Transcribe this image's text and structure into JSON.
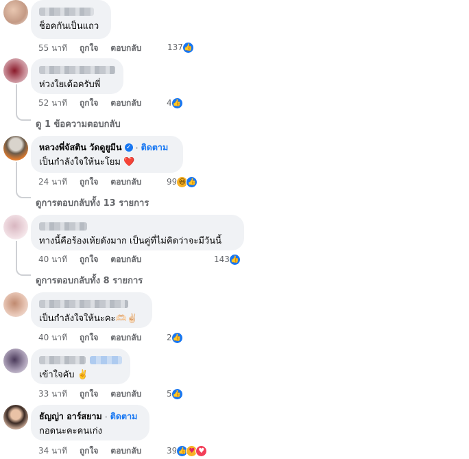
{
  "actions": {
    "like": "ถูกใจ",
    "reply": "ตอบกลับ"
  },
  "comments": [
    {
      "time": "55 นาที",
      "text": "ช็อคกันเป็นแถว",
      "count": "137"
    },
    {
      "time": "52 นาที",
      "text": "ห่วงใยเด้อครับพี่",
      "count": "4",
      "replies": "ดู 1 ข้อความตอบกลับ"
    },
    {
      "name": "หลวงพี่จัสติน วัดดูยูมีน",
      "follow": "ติดตาม",
      "time": "24 นาที",
      "text": "เป็นกำลังใจให้นะโยม ❤️",
      "count": "99",
      "replies": "ดูการตอบกลับทั้ง 13 รายการ"
    },
    {
      "time": "40 นาที",
      "text": "ทางนี้คือร้องเห้ยดังมาก เป็นคู่ที่ไม่คิดว่าจะมีวันนี้",
      "count": "143",
      "replies": "ดูการตอบกลับทั้ง 8 รายการ"
    },
    {
      "time": "40 นาที",
      "text": "เป็นกำลังใจให้นะคะ🫶🏻✌🏻",
      "count": "2"
    },
    {
      "time": "33 นาที",
      "text": "เข้าใจคับ ✌️",
      "count": "5"
    },
    {
      "name": "ธัญญ่า อาร์สยาม",
      "follow": "ติดตาม",
      "time": "34 นาที",
      "text": "กอดนะคะคนเก่ง",
      "count": "39"
    }
  ],
  "icons": [
    "like-reaction-icon",
    "haha-reaction-icon",
    "care-reaction-icon",
    "love-reaction-icon",
    "verified-badge-icon"
  ],
  "colors": {
    "like_blue": "#1877f2",
    "bubble_bg": "#f0f2f5",
    "meta_gray": "#65676b"
  }
}
